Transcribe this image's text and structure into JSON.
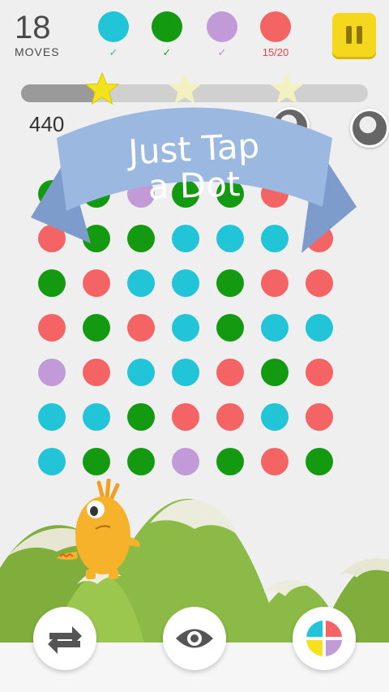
{
  "hud": {
    "moves_count": "18",
    "moves_label": "MOVES",
    "goals": [
      {
        "color": "#22c4d8",
        "status": "✓",
        "status_color": "#3fb6c6",
        "icon": "check-icon"
      },
      {
        "color": "#139a11",
        "status": "✓",
        "status_color": "#2d9b2a",
        "icon": "check-icon"
      },
      {
        "color": "#c39ad8",
        "status": "✓",
        "status_color": "#b790cf",
        "icon": "check-icon"
      },
      {
        "color": "#f56464",
        "status": "15/20",
        "status_color": "#e04848",
        "icon": ""
      }
    ],
    "pause_color": "#f5d81d"
  },
  "progress": {
    "fill_fraction": 0.21,
    "score": "440",
    "stars_earned": 1,
    "stars_total": 3
  },
  "banner": {
    "line1": "Just Tap",
    "line2": "a Dot",
    "color": "#9bb8e0"
  },
  "board": {
    "palette": {
      "r": "#f56464",
      "b": "#22c4d8",
      "g": "#139a11",
      "p": "#c39ad8"
    },
    "rows": [
      "g g p g g r r",
      "r g g b b b r",
      "g r b b g r r",
      "r g r b g b b",
      "p r b b r g r",
      "b b g r r b r",
      "b g g p g r g"
    ]
  },
  "toolbar": {
    "buttons": [
      {
        "name": "shuffle",
        "icon": "shuffle-arrows-icon"
      },
      {
        "name": "expander",
        "icon": "eye-icon"
      },
      {
        "name": "color-pick",
        "icon": "color-quad-icon"
      }
    ]
  }
}
